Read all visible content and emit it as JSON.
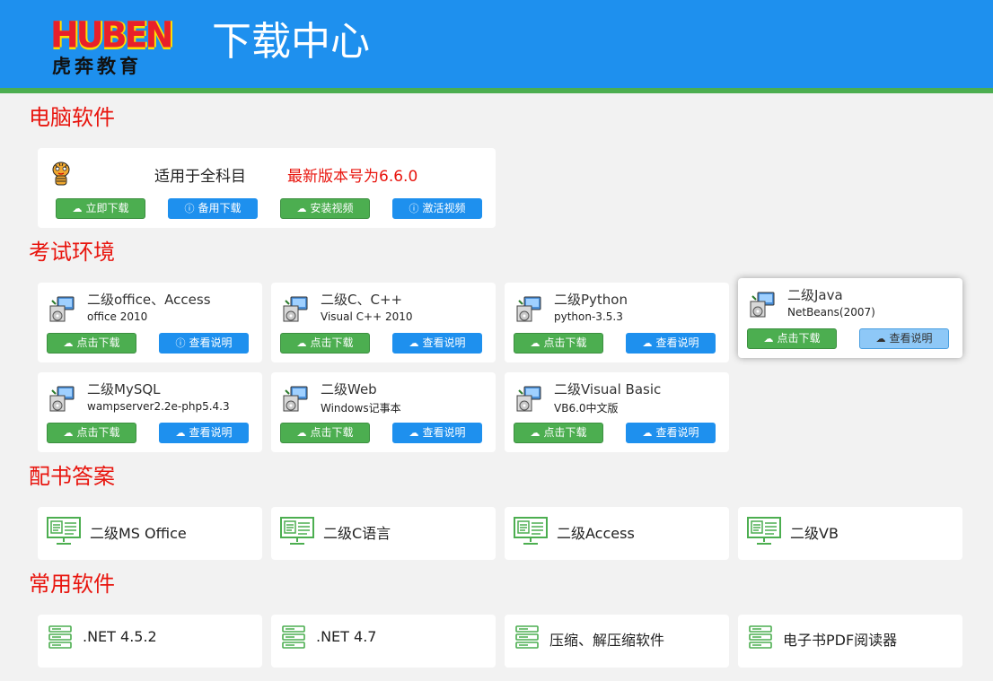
{
  "header": {
    "logo_top": "HUBEN",
    "logo_bottom": "虎奔教育",
    "title": "下载中心"
  },
  "sections": {
    "software": "电脑软件",
    "exam": "考试环境",
    "answers": "配书答案",
    "common": "常用软件"
  },
  "software_card": {
    "label": "适用于全科目",
    "version": "最新版本号为6.6.0",
    "buttons": [
      "立即下载",
      "备用下载",
      "安装视频",
      "激活视频"
    ]
  },
  "exam_cards": [
    {
      "name": "二级office、Access",
      "sub": "office 2010",
      "download": "点击下载",
      "info": "查看说明"
    },
    {
      "name": "二级C、C++",
      "sub": "Visual C++ 2010",
      "download": "点击下载",
      "info": "查看说明"
    },
    {
      "name": "二级Python",
      "sub": "python-3.5.3",
      "download": "点击下载",
      "info": "查看说明"
    },
    {
      "name": "二级Java",
      "sub": "NetBeans(2007)",
      "download": "点击下载",
      "info": "查看说明"
    },
    {
      "name": "二级MySQL",
      "sub": "wampserver2.2e-php5.4.3",
      "download": "点击下载",
      "info": "查看说明"
    },
    {
      "name": "二级Web",
      "sub": "Windows记事本",
      "download": "点击下载",
      "info": "查看说明"
    },
    {
      "name": "二级Visual Basic",
      "sub": "VB6.0中文版",
      "download": "点击下载",
      "info": "查看说明"
    }
  ],
  "answer_cards": [
    "二级MS Office",
    "二级C语言",
    "二级Access",
    "二级VB"
  ],
  "common_cards": [
    ".NET 4.5.2",
    ".NET 4.7",
    "压缩、解压缩软件",
    "电子书PDF阅读器"
  ],
  "colors": {
    "header_blue": "#1e90ee",
    "accent_green": "#4cae50",
    "section_red": "#e8150e"
  }
}
